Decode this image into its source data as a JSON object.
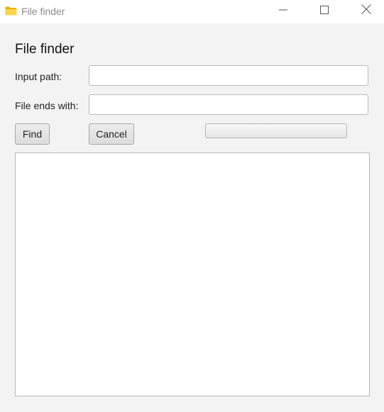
{
  "window": {
    "title": "File finder",
    "icons": {
      "app": "folder-icon",
      "minimize": "minimize-icon",
      "maximize": "maximize-icon",
      "close": "close-icon"
    },
    "app_icon_color": "#f4c430"
  },
  "main": {
    "heading": "File finder",
    "input_path": {
      "label": "Input path:",
      "value": "",
      "placeholder": ""
    },
    "file_ends_with": {
      "label": "File ends with:",
      "value": "",
      "placeholder": ""
    },
    "buttons": {
      "find_label": "Find",
      "cancel_label": "Cancel"
    },
    "progress": {
      "value": 0
    },
    "results": {
      "items": []
    }
  }
}
